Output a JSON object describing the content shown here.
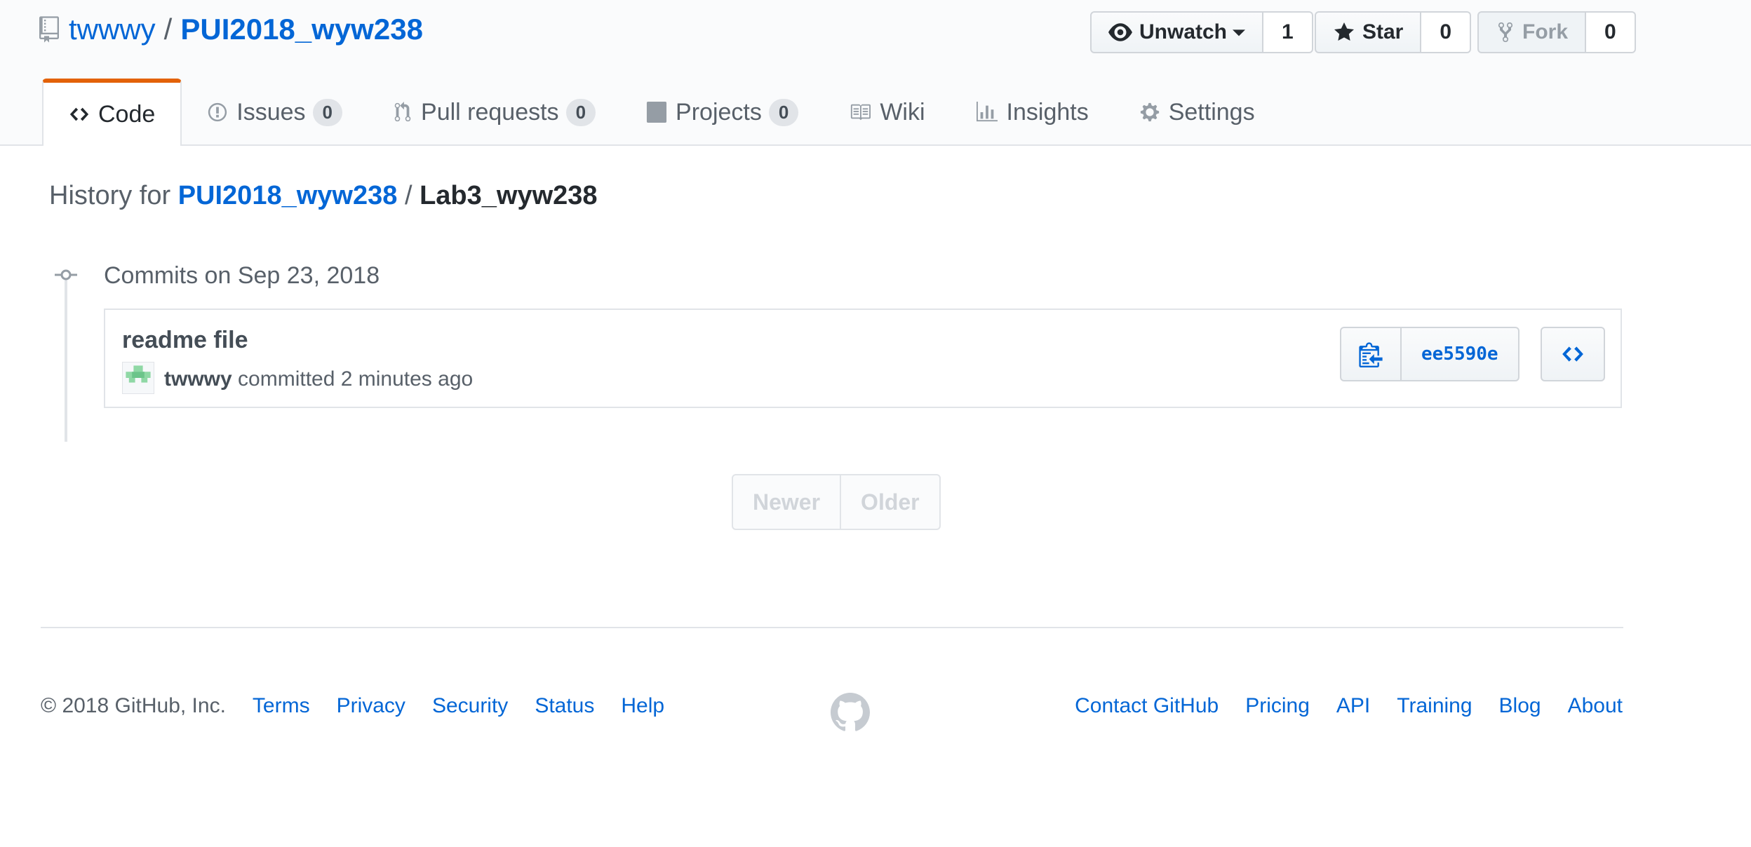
{
  "repo": {
    "owner": "twwwy",
    "separator": "/",
    "name": "PUI2018_wyw238"
  },
  "actions": {
    "watch_label": "Unwatch",
    "watch_count": "1",
    "star_label": "Star",
    "star_count": "0",
    "fork_label": "Fork",
    "fork_count": "0"
  },
  "tabs": [
    {
      "label": "Code",
      "icon": "code-icon"
    },
    {
      "label": "Issues",
      "count": "0",
      "icon": "issue-icon"
    },
    {
      "label": "Pull requests",
      "count": "0",
      "icon": "pull-request-icon"
    },
    {
      "label": "Projects",
      "count": "0",
      "icon": "project-icon"
    },
    {
      "label": "Wiki",
      "icon": "book-icon"
    },
    {
      "label": "Insights",
      "icon": "graph-icon"
    },
    {
      "label": "Settings",
      "icon": "gear-icon"
    }
  ],
  "history": {
    "prefix": "History for",
    "repo": "PUI2018_wyw238",
    "separator": "/",
    "file": "Lab3_wyw238"
  },
  "commits": {
    "date_heading": "Commits on Sep 23, 2018",
    "items": [
      {
        "title": "readme file",
        "author": "twwwy",
        "meta": "committed 2 minutes ago",
        "sha": "ee5590e"
      }
    ]
  },
  "pagination": {
    "newer": "Newer",
    "older": "Older"
  },
  "footer": {
    "copyright": "© 2018 GitHub, Inc.",
    "left_links": [
      "Terms",
      "Privacy",
      "Security",
      "Status",
      "Help"
    ],
    "right_links": [
      "Contact GitHub",
      "Pricing",
      "API",
      "Training",
      "Blog",
      "About"
    ]
  },
  "colors": {
    "link": "#0366d6",
    "selected_tab_accent": "#e36209",
    "muted": "#586069"
  }
}
